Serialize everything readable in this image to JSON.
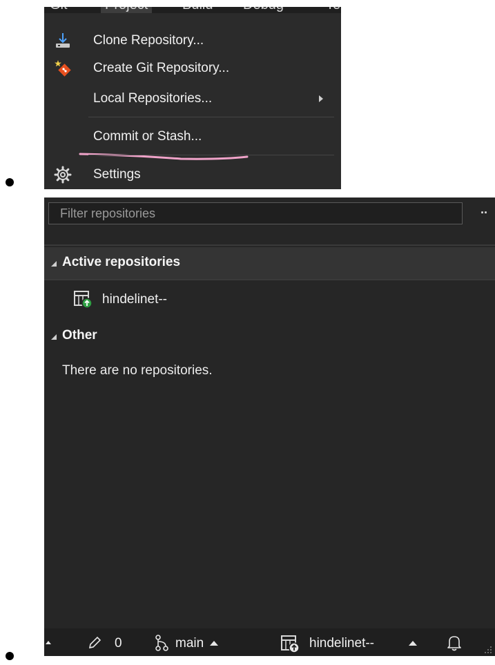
{
  "menu": {
    "menubar": [
      "Git",
      "Project",
      "Build",
      "Debug",
      "Te"
    ],
    "items": [
      {
        "label": "Clone Repository...",
        "icon": "clone-download-icon"
      },
      {
        "label": "Create Git Repository...",
        "icon": "create-git-repository-icon"
      },
      {
        "label": "Local Repositories...",
        "icon": "",
        "has_submenu": true
      },
      {
        "label": "Commit or Stash...",
        "icon": ""
      },
      {
        "label": "Settings",
        "icon": "gear-icon"
      }
    ],
    "annotation_color": "#f0a3c9"
  },
  "repo_panel": {
    "filter_placeholder": "Filter repositories",
    "more_label": "··",
    "groups": [
      {
        "title": "Active repositories",
        "items": [
          "hindelinet--"
        ]
      },
      {
        "title": "Other",
        "empty_message": "There are no repositories."
      }
    ]
  },
  "status_bar": {
    "pending_changes": "0",
    "branch": "main",
    "repository": "hindelinet--"
  },
  "colors": {
    "panel_bg": "#262626",
    "menu_bg": "#2b2b2b",
    "git_orange": "#e8501f",
    "repo_badge_green": "#2ea043"
  }
}
